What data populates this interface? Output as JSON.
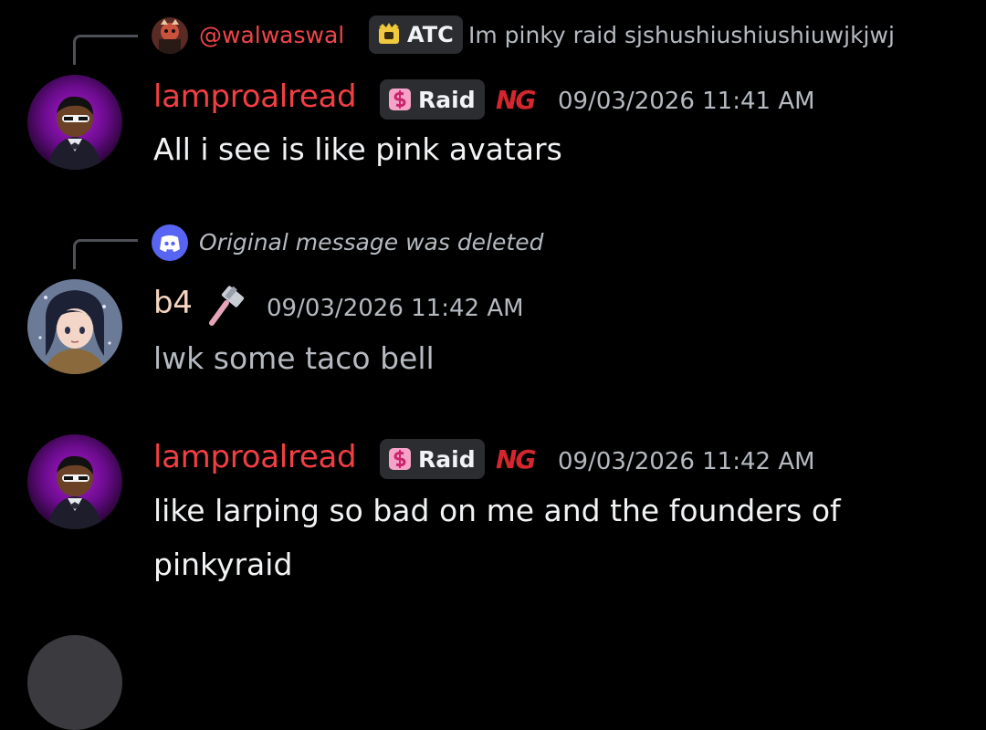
{
  "messages": [
    {
      "reply": {
        "username": "@walwaswal",
        "tag": "ATC",
        "text": "Im pinky raid sjshushiushiushiuwjkjwj"
      },
      "username": "lamproalread",
      "tag": "Raid",
      "ng_badge": "NG",
      "timestamp": "09/03/2026 11:41 AM",
      "text": "All i see is like pink avatars"
    },
    {
      "reply": {
        "deleted_text": "Original message was deleted"
      },
      "username": "b4",
      "timestamp": "09/03/2026 11:42 AM",
      "text": "lwk some taco bell"
    },
    {
      "username": "lamproalread",
      "tag": "Raid",
      "ng_badge": "NG",
      "timestamp": "09/03/2026 11:42 AM",
      "text_lines": [
        "like larping so bad on me and the founders of",
        "pinkyraid"
      ]
    }
  ],
  "colors": {
    "background": "#000000",
    "username_red": "#f23f43",
    "username_b4": "#f5d5c0",
    "reply_username": "#f0454a",
    "discord_blurple": "#5865f2",
    "tag_bg": "#2b2d31",
    "muted": "#b5bac1"
  },
  "icons": [
    "hammer-icon",
    "discord-icon",
    "raid-tag-icon",
    "atc-tag-icon"
  ]
}
